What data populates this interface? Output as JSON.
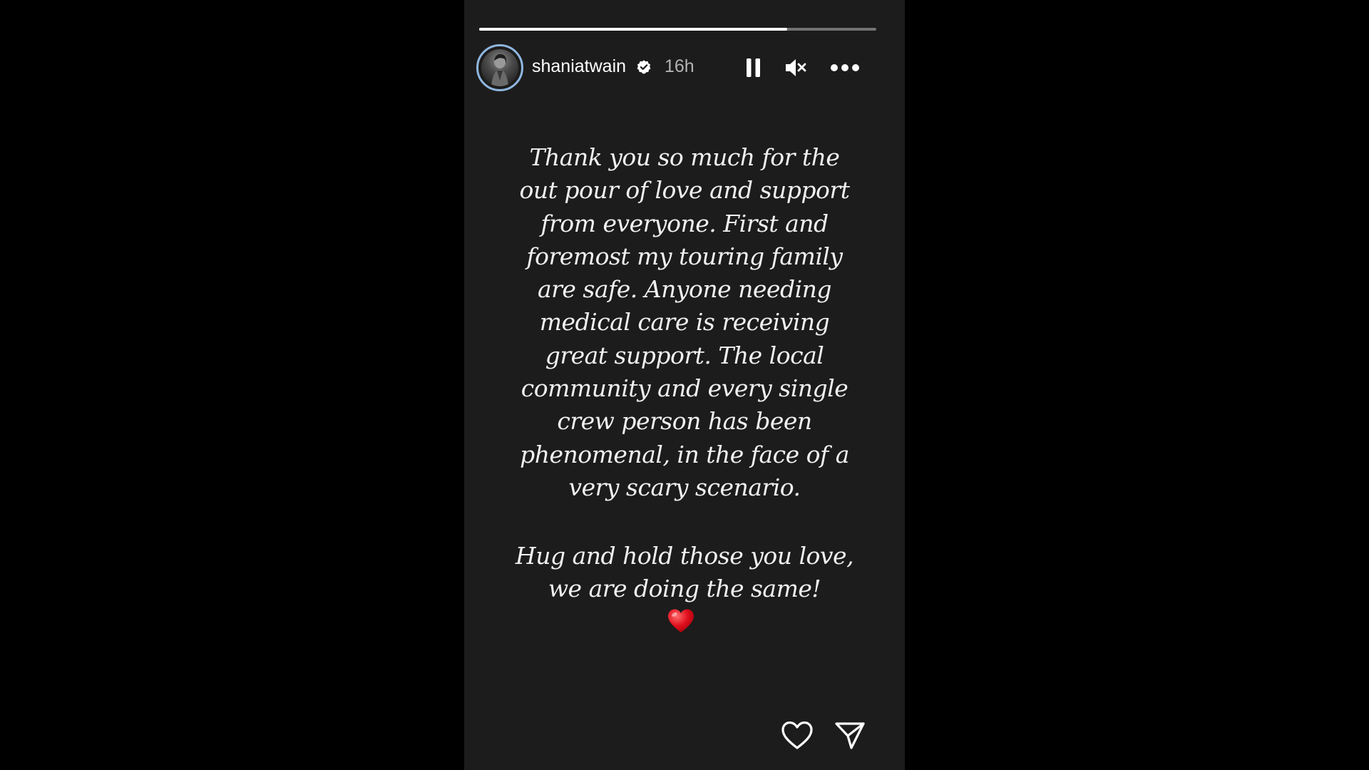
{
  "story": {
    "progress": 0.775,
    "author": {
      "username": "shaniatwain",
      "verified": true,
      "timestamp": "16h"
    },
    "controls": {
      "pause_icon": "pause-icon",
      "mute_icon": "muted-speaker-icon",
      "more_icon": "more-options-icon"
    },
    "text": {
      "paragraph_1": "Thank you so much for the\nout pour of love and support\nfrom everyone. First and\nforemost my touring family\nare safe. Anyone needing\nmedical care is receiving\ngreat support. The local\ncommunity and every single\ncrew person has been\nphenomenal, in the face of a\nvery scary scenario.",
      "paragraph_2": "Hug and hold those you love,\nwe are doing the same!",
      "emoji": "red-heart-emoji"
    },
    "actions": {
      "like_icon": "heart-outline-icon",
      "send_icon": "send-icon"
    },
    "colors": {
      "background": "#1c1c1c",
      "page_background": "#000000",
      "avatar_ring": "#8fb6df",
      "text": "#f1f1f1",
      "timestamp": "#b3b3b3",
      "heart_emoji": "#e0101e"
    }
  }
}
